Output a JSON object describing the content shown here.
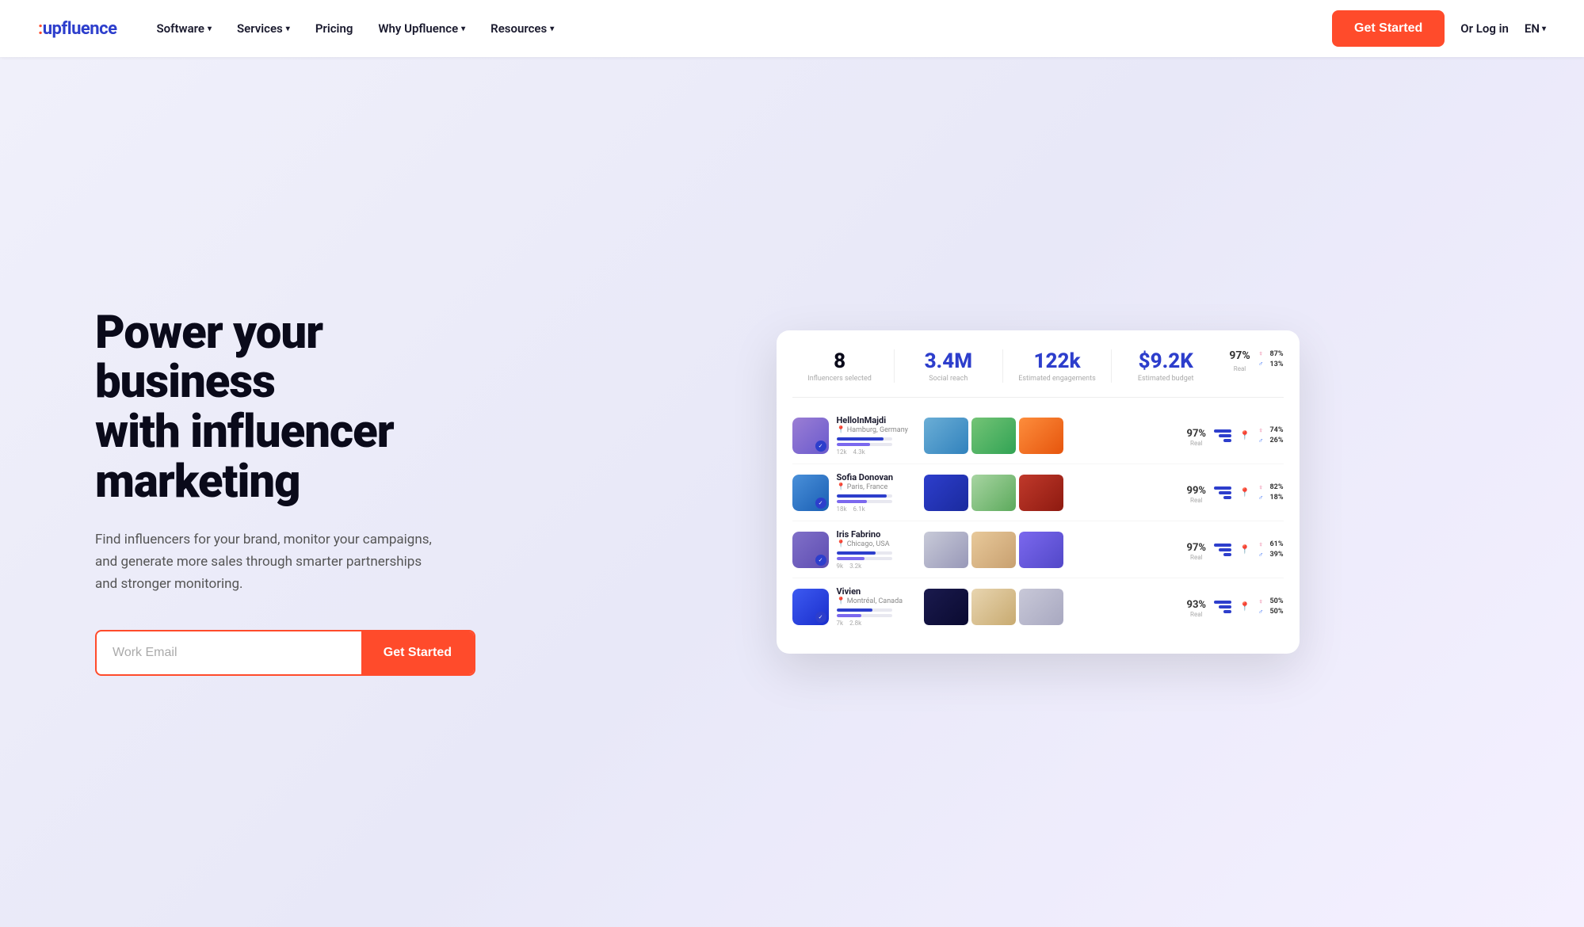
{
  "brand": {
    "name": "upfluence",
    "dot_char": "·"
  },
  "nav": {
    "links": [
      {
        "label": "Software",
        "has_dropdown": true
      },
      {
        "label": "Services",
        "has_dropdown": true
      },
      {
        "label": "Pricing",
        "has_dropdown": false
      },
      {
        "label": "Why Upfluence",
        "has_dropdown": true
      },
      {
        "label": "Resources",
        "has_dropdown": true
      }
    ],
    "cta_label": "Get Started",
    "login_label": "Or Log in",
    "lang_label": "EN"
  },
  "hero": {
    "title_line1": "Power your business",
    "title_line2": "with influencer",
    "title_line3": "marketing",
    "subtitle": "Find influencers for your brand, monitor your campaigns, and generate more sales through smarter partnerships and stronger monitoring.",
    "email_placeholder": "Work Email",
    "cta_label": "Get Started"
  },
  "dashboard": {
    "stats": [
      {
        "value": "8",
        "label": "Influencers selected",
        "color": "dark"
      },
      {
        "value": "3.4M",
        "label": "Social reach",
        "color": "blue"
      },
      {
        "value": "122k",
        "label": "Estimated engagements",
        "color": "blue"
      },
      {
        "value": "$9.2K",
        "label": "Estimated budget",
        "color": "blue"
      }
    ],
    "overall_stats": {
      "real_pct": "97%",
      "real_label": "Real",
      "female_pct": "87%",
      "male_pct": "13%"
    },
    "influencers": [
      {
        "name": "HelloInMajdi",
        "location": "Hamburg, Germany",
        "avatar_color": "#8b7cd4",
        "real_pct": "97%",
        "female_pct": "74%",
        "male_pct": "26%",
        "bar1_w": 85,
        "bar2_w": 60,
        "photos": [
          "#6baed6",
          "#74c476",
          "#fd8d3c"
        ]
      },
      {
        "name": "Sofia Donovan",
        "location": "Paris, France",
        "avatar_color": "#4a90d9",
        "real_pct": "99%",
        "female_pct": "82%",
        "male_pct": "18%",
        "bar1_w": 90,
        "bar2_w": 55,
        "photos": [
          "#2d3ecc",
          "#a8d5a2",
          "#c0392b"
        ]
      },
      {
        "name": "Iris Fabrino",
        "location": "Chicago, USA",
        "avatar_color": "#6c5ce7",
        "real_pct": "97%",
        "female_pct": "61%",
        "male_pct": "39%",
        "bar1_w": 70,
        "bar2_w": 50,
        "photos": [
          "#b8bcc8",
          "#e8c99a",
          "#7b68ee"
        ]
      },
      {
        "name": "Vivien",
        "location": "Montréal, Canada",
        "avatar_color": "#2d3ecc",
        "real_pct": "93%",
        "female_pct": "50%",
        "male_pct": "50%",
        "bar1_w": 65,
        "bar2_w": 45,
        "photos": [
          "#1a1a4e",
          "#e8d5b0",
          "#c8c8d8"
        ]
      }
    ]
  }
}
